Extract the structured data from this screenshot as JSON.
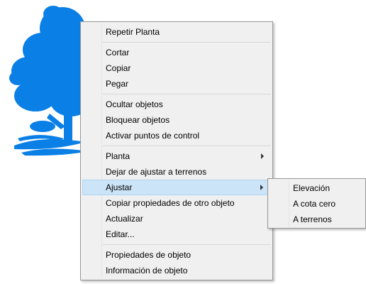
{
  "context_menu": {
    "items": [
      {
        "label": "Repetir Planta"
      },
      {
        "label": "Cortar"
      },
      {
        "label": "Copiar"
      },
      {
        "label": "Pegar"
      },
      {
        "label": "Ocultar objetos"
      },
      {
        "label": "Bloquear objetos"
      },
      {
        "label": "Activar puntos de control"
      },
      {
        "label": "Planta"
      },
      {
        "label": "Dejar de ajustar a terrenos"
      },
      {
        "label": "Ajustar"
      },
      {
        "label": "Copiar propiedades de otro objeto"
      },
      {
        "label": "Actualizar"
      },
      {
        "label": "Editar..."
      },
      {
        "label": "Propiedades de objeto"
      },
      {
        "label": "Información de objeto"
      }
    ]
  },
  "submenu": {
    "items": [
      {
        "label": "Elevación"
      },
      {
        "label": "A cota cero"
      },
      {
        "label": "A terrenos"
      }
    ]
  },
  "colors": {
    "tree": "#0a7fe6",
    "menu_background": "#f0f0f0",
    "highlight": "#cce4f7"
  },
  "canvas": {
    "object_icon": "tree-icon"
  }
}
